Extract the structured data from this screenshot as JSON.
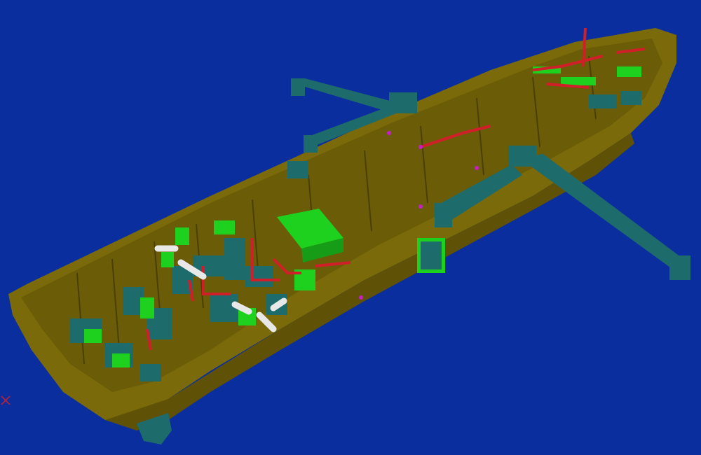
{
  "viewport": {
    "background_color": "#0a2e9e",
    "model": {
      "hull_color": "#7a6a0a",
      "hull_shadow_color": "#5f5206",
      "equipment_colors": [
        "#1e6b6b",
        "#1fd11f",
        "#d11f2a",
        "#e8e8e8",
        "#c41fc4"
      ],
      "davit_color": "#1e6b6b"
    },
    "axis_triad_icon": "axis-cross-icon"
  }
}
